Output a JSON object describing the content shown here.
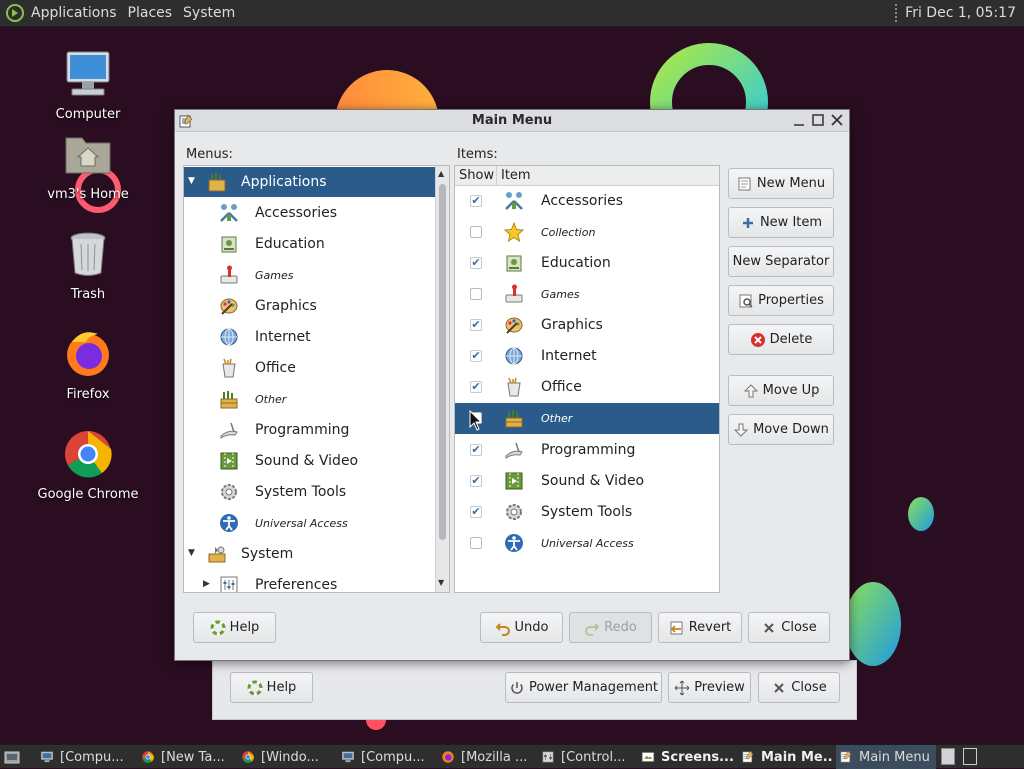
{
  "top_panel": {
    "menus": [
      "Applications",
      "Places",
      "System"
    ],
    "clock": "Fri Dec 1, 05:17"
  },
  "desktop": {
    "icons": [
      {
        "label": "Computer",
        "icon": "computer-icon"
      },
      {
        "label": "vm3's Home",
        "icon": "home-folder-icon"
      },
      {
        "label": "Trash",
        "icon": "trash-icon"
      },
      {
        "label": "Firefox",
        "icon": "firefox-icon"
      },
      {
        "label": "Google Chrome",
        "icon": "chrome-icon"
      }
    ]
  },
  "bg_dialog": {
    "help": "Help",
    "power": "Power Management",
    "preview": "Preview",
    "close": "Close"
  },
  "window": {
    "title": "Main Menu",
    "menus_label": "Menus:",
    "items_label": "Items:",
    "menus_tree": [
      {
        "label": "Applications",
        "icon": "applications-icon",
        "level": 0,
        "expanded": true,
        "selected": true,
        "italic": false
      },
      {
        "label": "Accessories",
        "icon": "accessories-icon",
        "level": 1,
        "italic": false
      },
      {
        "label": "Education",
        "icon": "education-icon",
        "level": 1,
        "italic": false
      },
      {
        "label": "Games",
        "icon": "games-icon",
        "level": 1,
        "italic": true
      },
      {
        "label": "Graphics",
        "icon": "graphics-icon",
        "level": 1,
        "italic": false
      },
      {
        "label": "Internet",
        "icon": "internet-icon",
        "level": 1,
        "italic": false
      },
      {
        "label": "Office",
        "icon": "office-icon",
        "level": 1,
        "italic": false
      },
      {
        "label": "Other",
        "icon": "other-icon",
        "level": 1,
        "italic": true
      },
      {
        "label": "Programming",
        "icon": "programming-icon",
        "level": 1,
        "italic": false
      },
      {
        "label": "Sound & Video",
        "icon": "sound-video-icon",
        "level": 1,
        "italic": false
      },
      {
        "label": "System Tools",
        "icon": "system-tools-icon",
        "level": 1,
        "italic": false
      },
      {
        "label": "Universal Access",
        "icon": "universal-access-icon",
        "level": 1,
        "italic": true
      },
      {
        "label": "System",
        "icon": "system-icon",
        "level": 0,
        "expanded": true,
        "italic": false
      },
      {
        "label": "Preferences",
        "icon": "preferences-icon",
        "level": 1,
        "expander": "collapsed",
        "italic": false
      }
    ],
    "items_columns": [
      "Show",
      "Item"
    ],
    "items": [
      {
        "label": "Accessories",
        "shown": true,
        "icon": "accessories-icon",
        "italic": false
      },
      {
        "label": "Collection",
        "shown": false,
        "icon": "star-icon",
        "italic": true
      },
      {
        "label": "Education",
        "shown": true,
        "icon": "education-icon",
        "italic": false
      },
      {
        "label": "Games",
        "shown": false,
        "icon": "games-icon",
        "italic": true
      },
      {
        "label": "Graphics",
        "shown": true,
        "icon": "graphics-icon",
        "italic": false
      },
      {
        "label": "Internet",
        "shown": true,
        "icon": "internet-icon",
        "italic": false
      },
      {
        "label": "Office",
        "shown": true,
        "icon": "office-icon",
        "italic": false
      },
      {
        "label": "Other",
        "shown": false,
        "icon": "other-icon",
        "italic": true,
        "selected": true
      },
      {
        "label": "Programming",
        "shown": true,
        "icon": "programming-icon",
        "italic": false
      },
      {
        "label": "Sound & Video",
        "shown": true,
        "icon": "sound-video-icon",
        "italic": false
      },
      {
        "label": "System Tools",
        "shown": true,
        "icon": "system-tools-icon",
        "italic": false
      },
      {
        "label": "Universal Access",
        "shown": false,
        "icon": "universal-access-icon",
        "italic": true
      }
    ],
    "buttons": {
      "new_menu": "New Menu",
      "new_item": "New Item",
      "new_separator": "New Separator",
      "properties": "Properties",
      "delete": "Delete",
      "move_up": "Move Up",
      "move_down": "Move Down",
      "help": "Help",
      "undo": "Undo",
      "redo": "Redo",
      "revert": "Revert",
      "close": "Close"
    }
  },
  "taskbar": {
    "tasks": [
      {
        "label": "[Compu...",
        "icon": "computer-icon"
      },
      {
        "label": "[New Ta...",
        "icon": "chrome-icon"
      },
      {
        "label": "[Windo...",
        "icon": "chrome-icon"
      },
      {
        "label": "[Compu...",
        "icon": "computer-icon"
      },
      {
        "label": "[Mozilla ...",
        "icon": "firefox-icon"
      },
      {
        "label": "[Control...",
        "icon": "control-icon"
      },
      {
        "label": "Screens...",
        "icon": "screenshot-icon",
        "bold": true
      },
      {
        "label": "Main Me...",
        "icon": "menu-editor-icon",
        "bold": true
      },
      {
        "label": "Main Menu",
        "icon": "menu-editor-icon",
        "active": true
      }
    ]
  },
  "colors": {
    "desktop_bg": "#2b0d22",
    "selection": "#2a5b8b",
    "panel": "#2e2e2e"
  }
}
